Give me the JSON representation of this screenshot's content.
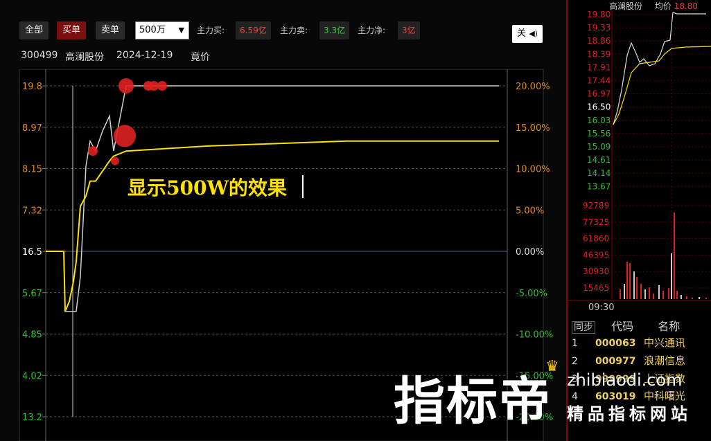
{
  "toolbar": {
    "all_label": "全部",
    "buy_label": "买单",
    "sell_label": "卖单",
    "amount_select": "500万",
    "main_buy_label": "主力买:",
    "main_buy_value": "6.59亿",
    "main_sell_label": "主力卖:",
    "main_sell_value": "3.3亿",
    "main_net_label": "主力净:",
    "main_net_value": "3亿",
    "close_label": "关"
  },
  "stock_info": {
    "code": "300499",
    "name": "高澜股份",
    "date": "2024-12-19",
    "phase": "竟价"
  },
  "annotation": "显示500W的效果",
  "main_chart": {
    "left_ticks": [
      "19.8",
      "8.97",
      "8.15",
      "7.32",
      "16.5",
      "5.67",
      "4.85",
      "4.02",
      "13.2"
    ],
    "right_ticks": [
      "20.00%",
      "15.00%",
      "10.00%",
      "5.00%",
      "0.00%",
      "-5.00%",
      "-10.00%",
      "-15.00%",
      "-20.00%"
    ]
  },
  "chart_data": {
    "type": "line",
    "title": "",
    "series": [
      {
        "name": "",
        "values": [
          16.5,
          16.5,
          16.5,
          16.5,
          16.5,
          16.5,
          16.5,
          16.5,
          15.3,
          15.3,
          15.3,
          15.3,
          16.0,
          18.2,
          18.7,
          18.5,
          18.9,
          19.2,
          18.5,
          19.8,
          19.8,
          19.8,
          19.8
        ]
      },
      {
        "name": "",
        "values": [
          16.5,
          16.5,
          16.5,
          16.5,
          16.5,
          16.5,
          16.5,
          16.5,
          15.3,
          15.5,
          15.9,
          16.3,
          17.4,
          17.6,
          17.9,
          17.9,
          18.1,
          18.3,
          18.4,
          18.5,
          18.6,
          18.7,
          18.7
        ]
      }
    ],
    "buy_markers": [
      19.8,
      19.8,
      19.8,
      19.8,
      18.3,
      18.5,
      18.8
    ],
    "ylim": [
      13.2,
      19.8
    ]
  },
  "right_panel": {
    "stock_name": "高澜股份",
    "avg_label": "均价",
    "avg_value": "18.80",
    "price_ticks": [
      "19.80",
      "19.33",
      "18.86",
      "18.39",
      "17.91",
      "17.44",
      "16.97",
      "16.50",
      "16.03",
      "15.56",
      "15.09",
      "14.61",
      "14.14",
      "13.67"
    ],
    "volume_ticks": [
      "92789",
      "77325",
      "61860",
      "46395",
      "30930",
      "15465"
    ],
    "time_label": "09:30",
    "list_headers": {
      "sync": "同步",
      "code": "代码",
      "name": "名称"
    },
    "list": [
      {
        "idx": "1",
        "code": "000063",
        "name": "中兴通讯"
      },
      {
        "idx": "2",
        "code": "000977",
        "name": "浪潮信息"
      },
      {
        "idx": "3",
        "code": "999999",
        "name": "上证指数"
      },
      {
        "idx": "4",
        "code": "603019",
        "name": "中科曙光"
      }
    ]
  },
  "watermark": {
    "brand": "指标帝",
    "site": "zhibiaodi.com",
    "slogan": "精品指标网站"
  },
  "colors": {
    "up": "#e02020",
    "down": "#30c030",
    "avg_line": "#ffe100",
    "price_line": "#d0d0d0",
    "orange_axis": "#e08a1e"
  }
}
